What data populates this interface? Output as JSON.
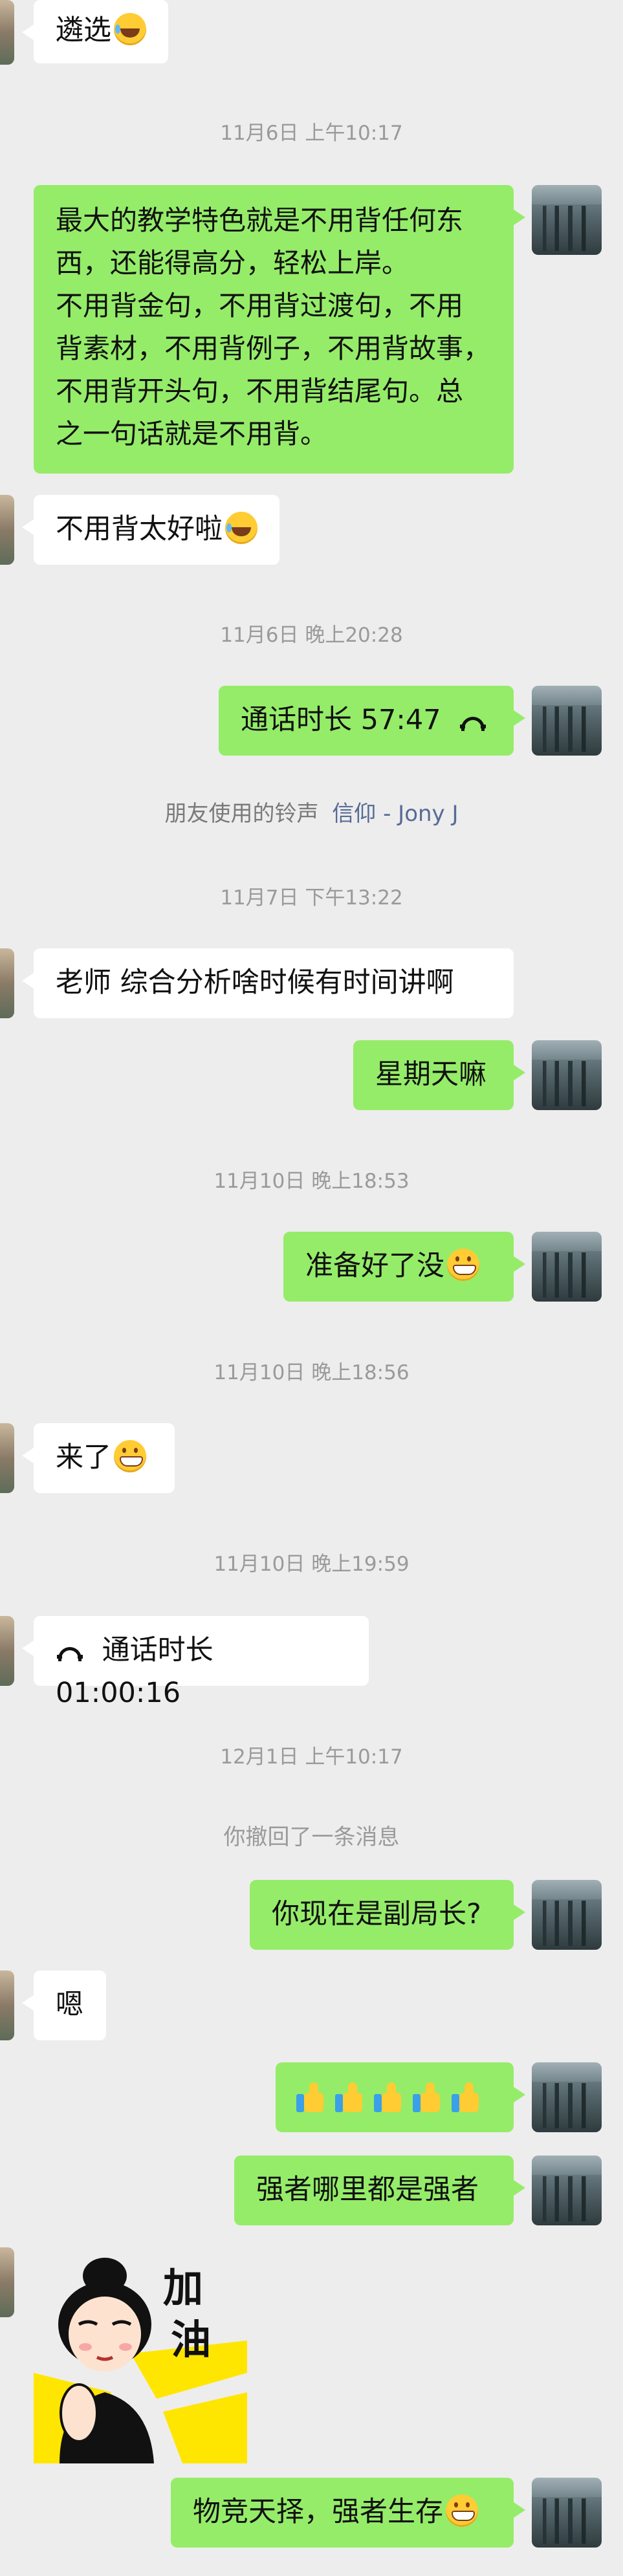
{
  "messages": {
    "m1": {
      "text": "遴选",
      "emoji": "laugh-emoji"
    },
    "t1": "11月6日 上午10:17",
    "m2": {
      "lines": [
        "最大的教学特色就是不用背任何东",
        "西，还能得高分，轻松上岸。",
        "不用背金句，不用背过渡句，不用",
        "背素材，不用背例子，不用背故事，",
        "不用背开头句，不用背结尾句。总",
        "之一句话就是不用背。"
      ]
    },
    "m3": {
      "text": "不用背太好啦",
      "emoji": "laugh-emoji"
    },
    "t2": "11月6日 晚上20:28",
    "m4": {
      "text": "通话时长 57:47",
      "icon": "phone-hangup-icon"
    },
    "notice1": {
      "prefix": "朋友使用的铃声",
      "link": "信仰 - Jony J"
    },
    "t3": "11月7日 下午13:22",
    "m5": {
      "text": "老师 综合分析啥时候有时间讲啊"
    },
    "m6": {
      "text": "星期天嘛"
    },
    "t4": "11月10日 晚上18:53",
    "m7": {
      "text": "准备好了没",
      "emoji": "grin-emoji"
    },
    "t5": "11月10日 晚上18:56",
    "m8": {
      "text": "来了",
      "emoji": "grin-emoji"
    },
    "t6": "11月10日 晚上19:59",
    "m9": {
      "text": "通话时长 01:00:16",
      "icon": "phone-hangup-icon"
    },
    "t7": "12月1日 上午10:17",
    "notice2": "你撤回了一条消息",
    "m10": {
      "text": "你现在是副局长?"
    },
    "m11": {
      "text": "嗯"
    },
    "m12": {
      "emoji": "thumbs-up-emoji",
      "count": 5
    },
    "m13": {
      "text": "强者哪里都是强者"
    },
    "m14": {
      "sticker_text": [
        "加",
        "油"
      ]
    },
    "m15": {
      "text": "物竞天择，强者生存",
      "emoji": "grin-emoji"
    }
  },
  "colors": {
    "background": "#ededed",
    "my_bubble": "#95ec69",
    "other_bubble": "#ffffff",
    "timestamp": "#9a9a9a",
    "link": "#576b95"
  }
}
